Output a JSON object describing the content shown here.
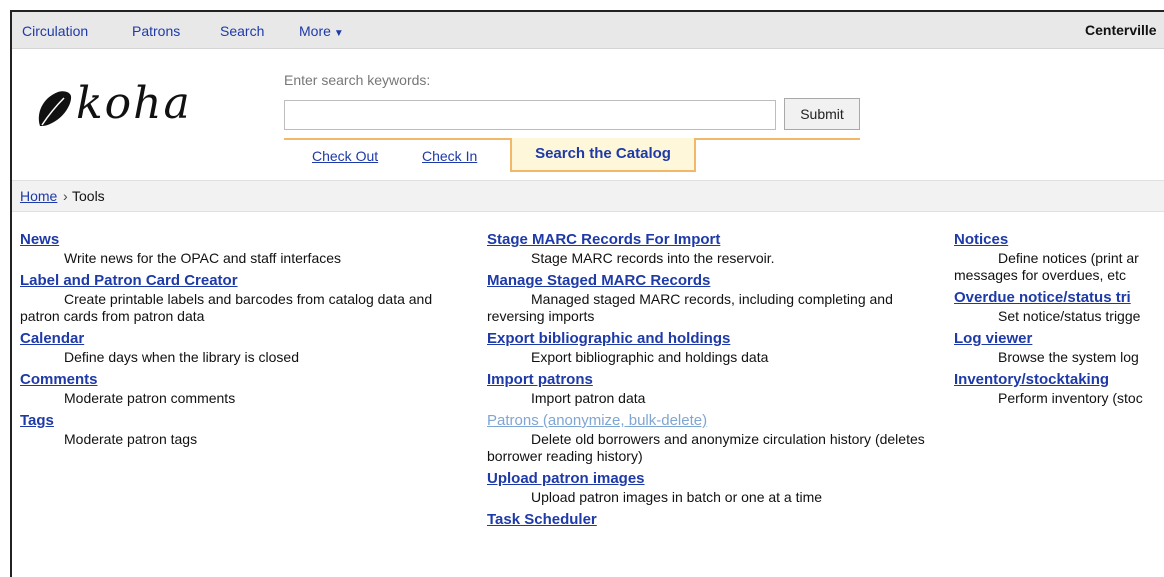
{
  "topnav": {
    "items": [
      "Circulation",
      "Patrons",
      "Search",
      "More"
    ],
    "library_name": "Centerville"
  },
  "header": {
    "logo_text": "koha",
    "search_label": "Enter search keywords:",
    "search_value": "",
    "submit_label": "Submit",
    "tabs": [
      "Check Out",
      "Check In",
      "Search the Catalog"
    ],
    "active_tab": "Search the Catalog"
  },
  "breadcrumb": {
    "home": "Home",
    "separator": "›",
    "current": "Tools"
  },
  "columns": {
    "col1": [
      {
        "title": "News",
        "desc": "Write news for the OPAC and staff interfaces"
      },
      {
        "title": "Label and Patron Card Creator",
        "desc": "Create printable labels and barcodes from catalog data and patron cards from patron data"
      },
      {
        "title": "Calendar",
        "desc": "Define days when the library is closed"
      },
      {
        "title": "Comments",
        "desc": "Moderate patron comments"
      },
      {
        "title": "Tags",
        "desc": "Moderate patron tags"
      }
    ],
    "col2": [
      {
        "title": "Stage MARC Records For Import",
        "desc": "Stage MARC records into the reservoir."
      },
      {
        "title": "Manage Staged MARC Records",
        "desc": "Managed staged MARC records, including completing and reversing imports"
      },
      {
        "title": "Export bibliographic and holdings",
        "desc": "Export bibliographic and holdings data"
      },
      {
        "title": "Import patrons",
        "desc": "Import patron data"
      },
      {
        "title": "Patrons (anonymize, bulk-delete)",
        "desc": "Delete old borrowers and anonymize circulation history (deletes borrower reading history)"
      },
      {
        "title": "Upload patron images",
        "desc": "Upload patron images in batch or one at a time"
      },
      {
        "title": "Task Scheduler",
        "desc": ""
      }
    ],
    "col3": [
      {
        "title": "Notices",
        "desc": "Define notices (print ar messages for overdues, etc"
      },
      {
        "title": "Overdue notice/status tri",
        "desc": "Set notice/status trigge"
      },
      {
        "title": "Log viewer",
        "desc": "Browse the system log"
      },
      {
        "title": "Inventory/stocktaking",
        "desc": "Perform inventory (stoc"
      }
    ]
  },
  "colors": {
    "link": "#1e3aa8",
    "visited_link": "#7fa6d2",
    "tab_accent": "#f1b86a",
    "tab_active_bg": "#fff7da",
    "nav_bg": "#e8e8e8"
  }
}
